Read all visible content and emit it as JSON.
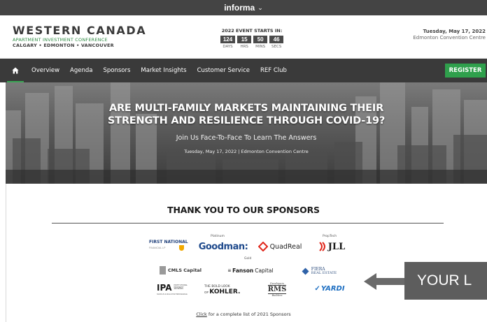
{
  "topbar": {
    "brand": "informa",
    "chevron": "⌄"
  },
  "header": {
    "logo": {
      "line1": "WESTERN CANADA",
      "line2": "APARTMENT INVESTMENT CONFERENCE",
      "line3": "CALGARY • EDMONTON • VANCOUVER"
    },
    "countdown": {
      "title": "2022 EVENT STARTS IN:",
      "units": [
        {
          "value": "124",
          "label": "DAYS"
        },
        {
          "value": "15",
          "label": "HRS"
        },
        {
          "value": "50",
          "label": "MINS"
        },
        {
          "value": "46",
          "label": "SECS"
        }
      ]
    },
    "event_date": "Tuesday, May 17, 2022",
    "event_venue": "Edmonton Convention Centre"
  },
  "nav": {
    "home_icon": "home-icon",
    "items": [
      "Overview",
      "Agenda",
      "Sponsors",
      "Market Insights",
      "Customer Service",
      "REF Club"
    ],
    "register_label": "REGISTER"
  },
  "hero": {
    "headline_line1": "ARE MULTI-FAMILY MARKETS MAINTAINING THEIR",
    "headline_line2": "STRENGTH AND RESILIENCE THROUGH COVID-19?",
    "subheading": "Join Us Face-To-Face To Learn The Answers",
    "dateline": "Tuesday, May 17, 2022 | Edmonton Convention Centre"
  },
  "sponsors": {
    "title": "THANK YOU TO OUR SPONSORS",
    "tiers": {
      "platinum": "Platinum",
      "proptech": "PropTech",
      "gold": "Gold"
    },
    "logos": {
      "first_national": {
        "name": "FIRST NATIONAL",
        "tag": "FINANCIAL LP"
      },
      "goodman": "Goodman:",
      "quadreal": "QuadReal",
      "jll": "JLL",
      "cmls": "CMLS Capital",
      "fanson": {
        "part1": "Fanson",
        "part2": "Capital"
      },
      "fiera": {
        "part1": "FIERA",
        "part2": "REAL ESTATE"
      },
      "ipa": {
        "main": "IPA",
        "tag1": "INSTITUTIONAL",
        "tag2": "PROPERTY",
        "tag3": "ADVISORS",
        "foot": "MARCUS & MILLICHAP BROKERAGE"
      },
      "kohler": {
        "line1": "THE BOLD LOOK",
        "line2": "OF",
        "line3": "KOHLER."
      },
      "rms": {
        "top": "Developers",
        "main": "RMS",
        "bottom": "Builders"
      },
      "yardi": "YARDI"
    },
    "click_link": "Click",
    "click_rest": " for a complete list of 2021 Sponsors"
  },
  "cta": {
    "text": "YOUR L"
  }
}
